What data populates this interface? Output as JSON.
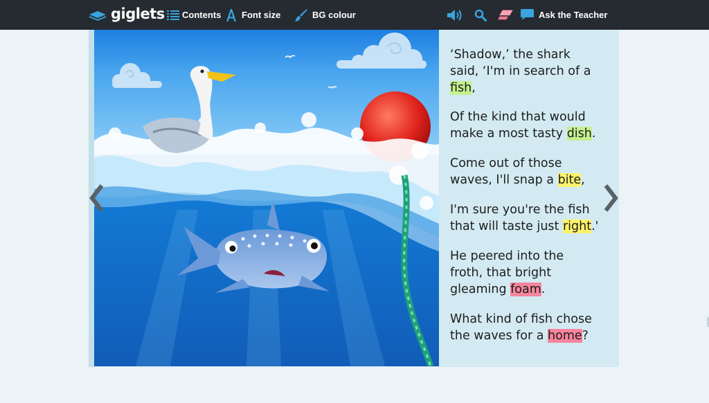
{
  "toolbar": {
    "logo": "giglets",
    "contents_label": "Contents",
    "font_size_label": "Font size",
    "bg_colour_label": "BG colour",
    "ask_teacher_label": "Ask the Teacher"
  },
  "page": {
    "stanzas": [
      {
        "lines": [
          "‘Shadow,’ the shark",
          "said, ‘I'm in search of a"
        ],
        "line3_word": "fish",
        "line3_after": ","
      },
      {
        "line1": "Of the kind that would",
        "line2_before": "make a most tasty ",
        "word": "dish",
        "line2_after": "."
      },
      {
        "line1": "Come out of those",
        "line2_before": "waves, I'll snap a ",
        "word": "bite",
        "line2_after": ","
      },
      {
        "line1": "I'm sure you're the fish",
        "line2_before": "that will taste just ",
        "word": "right",
        "line2_after": ".'"
      },
      {
        "line1": "He peered into the",
        "line2": "froth, that bright",
        "line3_before": "gleaming ",
        "word": "foam",
        "line3_after": "."
      },
      {
        "line1": "What kind of fish chose",
        "line2_before": "the waves for a ",
        "word": "home",
        "line2_after": "?"
      }
    ]
  },
  "colors": {
    "toolbar_bg": "#252b30",
    "accent_blue": "#3aa3e0",
    "highlight_green": "#c4f08f",
    "highlight_yellow": "#fbf46a",
    "highlight_pink": "#f7859d"
  },
  "icons": {
    "logo": "book-icon",
    "contents": "list-icon",
    "font_size": "letter-a-icon",
    "bg_colour": "paintbrush-icon",
    "audio": "speaker-icon",
    "search": "search-icon",
    "eraser": "eraser-icon",
    "ask": "speech-bubble-icon",
    "prev": "chevron-left-icon",
    "next": "chevron-right-icon"
  }
}
